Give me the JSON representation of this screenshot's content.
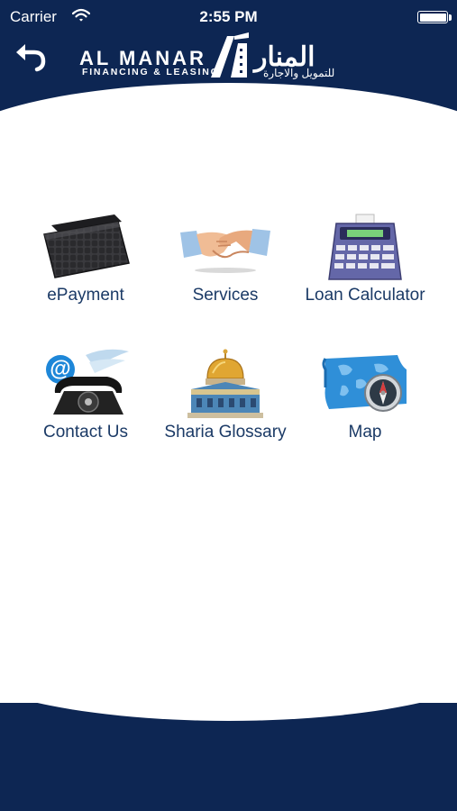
{
  "status_bar": {
    "carrier": "Carrier",
    "time": "2:55 PM"
  },
  "header": {
    "logo_english": "AL MANAR",
    "logo_tagline": "FINANCING & LEASING",
    "logo_arabic": "المنار",
    "logo_arabic_tagline": "للتمويل والاجارة",
    "back_icon": "undo-arrow-icon"
  },
  "menu": {
    "items": [
      {
        "label": "ePayment",
        "icon": "wallet-icon"
      },
      {
        "label": "Services",
        "icon": "handshake-icon"
      },
      {
        "label": "Loan Calculator",
        "icon": "calculator-icon"
      },
      {
        "label": "Contact Us",
        "icon": "telephone-email-icon"
      },
      {
        "label": "Sharia Glossary",
        "icon": "mosque-icon"
      },
      {
        "label": "Map",
        "icon": "map-compass-icon"
      }
    ]
  },
  "colors": {
    "brand_navy": "#0d2653",
    "label_text": "#1b3a66"
  }
}
